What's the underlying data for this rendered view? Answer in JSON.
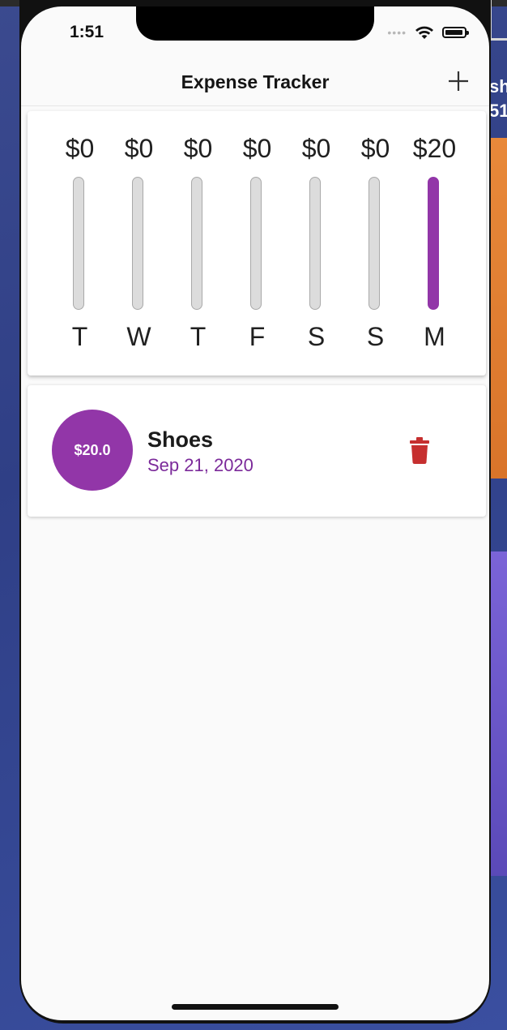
{
  "status_bar": {
    "time": "1:51",
    "signal": "••••"
  },
  "navbar": {
    "title": "Expense Tracker",
    "add_icon": "plus-icon"
  },
  "colors": {
    "accent": "#9236a8",
    "bar_empty": "#dcdcdc",
    "delete": "#c62f2f",
    "date_text": "#7b2a9a"
  },
  "chart_data": {
    "type": "bar",
    "categories": [
      "T",
      "W",
      "T",
      "F",
      "S",
      "S",
      "M"
    ],
    "amount_labels": [
      "$0",
      "$0",
      "$0",
      "$0",
      "$0",
      "$0",
      "$20"
    ],
    "values": [
      0,
      0,
      0,
      0,
      0,
      0,
      20
    ],
    "ylim": [
      0,
      20
    ]
  },
  "transactions": [
    {
      "amount": "$20.0",
      "title": "Shoes",
      "date": "Sep 21, 2020",
      "delete_icon": "trash-icon"
    }
  ],
  "desktop": {
    "peek_text": "sh\n51."
  }
}
